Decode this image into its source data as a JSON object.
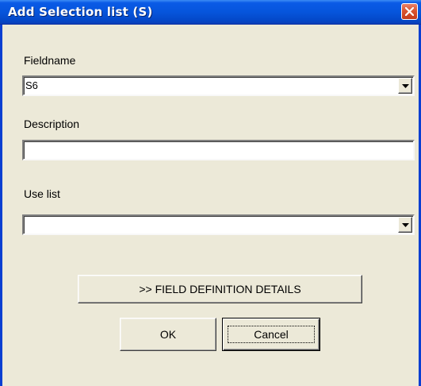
{
  "window": {
    "title": "Add Selection list (S)"
  },
  "form": {
    "fieldname": {
      "label": "Fieldname",
      "value": "S6"
    },
    "description": {
      "label": "Description",
      "value": ""
    },
    "use_list": {
      "label": "Use list",
      "value": ""
    }
  },
  "buttons": {
    "details_label": ">> FIELD DEFINITION DETAILS",
    "ok_label": "OK",
    "cancel_label": "Cancel"
  },
  "icons": {
    "close": "close-icon",
    "dropdown": "chevron-down-icon"
  },
  "colors": {
    "titlebar": "#0655dc",
    "window_bg": "#ece9d8",
    "close_button": "#d9542f"
  }
}
